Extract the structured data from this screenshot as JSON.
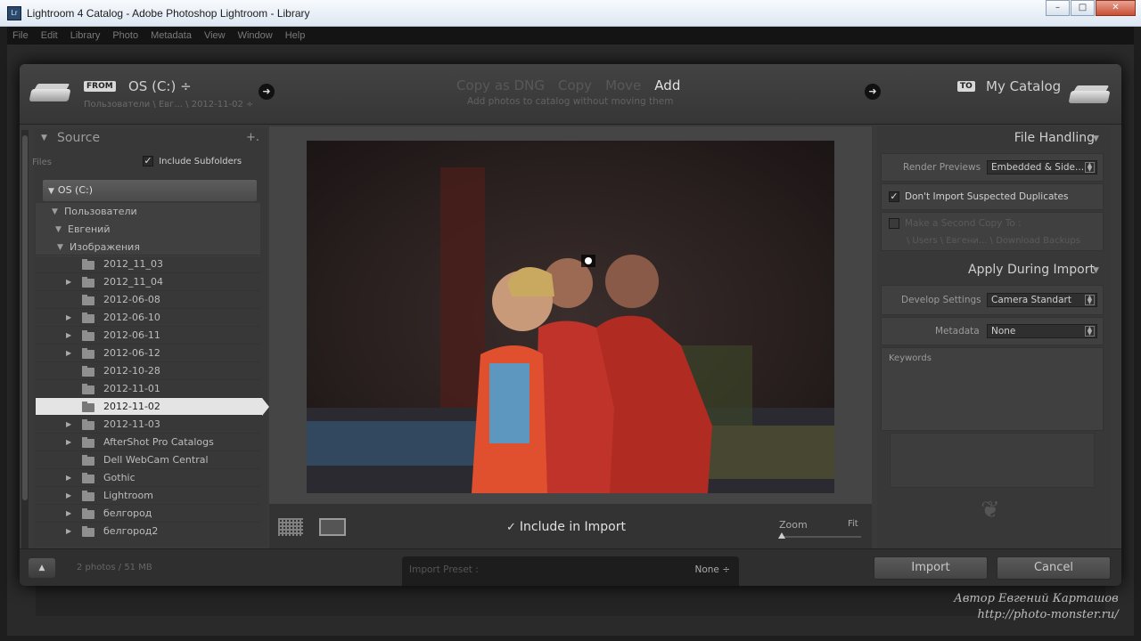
{
  "window": {
    "title": "Lightroom 4 Catalog - Adobe Photoshop Lightroom - Library",
    "app_icon": "Lr",
    "buttons": [
      "–",
      "□",
      "✕"
    ]
  },
  "menubar": {
    "items": [
      "File",
      "Edit",
      "Library",
      "Photo",
      "Metadata",
      "View",
      "Window",
      "Help"
    ]
  },
  "header": {
    "from_tag": "FROM",
    "source": "OS (C:) ÷",
    "source_path": "Пользователи \\ Евг... \\ 2012-11-02 ÷",
    "modes": [
      "Copy as DNG",
      "Copy",
      "Move",
      "Add"
    ],
    "active_mode": "Add",
    "mode_description": "Add photos to catalog without moving them",
    "to_tag": "TO",
    "destination": "My Catalog"
  },
  "source_panel": {
    "title": "Source",
    "add_symbol": "+.",
    "files_label": "Files",
    "include_subfolders": "Include Subfolders",
    "volume": "OS (C:)",
    "tree": [
      "Пользователи",
      "Евгений",
      "Изображения"
    ],
    "folders": [
      {
        "label": "2012_11_03",
        "expand": ""
      },
      {
        "label": "2012_11_04",
        "expand": "▶"
      },
      {
        "label": "2012-06-08",
        "expand": ""
      },
      {
        "label": "2012-06-10",
        "expand": "▶"
      },
      {
        "label": "2012-06-11",
        "expand": "▶"
      },
      {
        "label": "2012-06-12",
        "expand": "▶"
      },
      {
        "label": "2012-10-28",
        "expand": ""
      },
      {
        "label": "2012-11-01",
        "expand": ""
      },
      {
        "label": "2012-11-02",
        "expand": "",
        "selected": true
      },
      {
        "label": "2012-11-03",
        "expand": "▶"
      },
      {
        "label": "AfterShot Pro Catalogs",
        "expand": "▶"
      },
      {
        "label": "Dell WebCam Central",
        "expand": ""
      },
      {
        "label": "Gothic",
        "expand": "▶"
      },
      {
        "label": "Lightroom",
        "expand": "▶"
      },
      {
        "label": "белгород",
        "expand": "▶"
      },
      {
        "label": "белгород2",
        "expand": "▶"
      }
    ]
  },
  "center": {
    "include_in_import": "Include in Import",
    "zoom_label": "Zoom",
    "fit_label": "Fit"
  },
  "file_handling": {
    "title": "File Handling",
    "render_previews_label": "Render Previews",
    "render_previews_value": "Embedded & Side...",
    "dont_import_duplicates": "Don't Import Suspected Duplicates",
    "second_copy_label": "Make a Second Copy To :",
    "second_copy_path": "\\ Users \\ Евгени... \\ Download Backups"
  },
  "apply_during_import": {
    "title": "Apply During Import",
    "develop_settings_label": "Develop Settings",
    "develop_settings_value": "Camera Standart",
    "metadata_label": "Metadata",
    "metadata_value": "None",
    "keywords_label": "Keywords"
  },
  "footer": {
    "up_symbol": "▲",
    "photo_count": "2 photos / 51 MB",
    "import_preset_label": "Import Preset :",
    "import_preset_value": "None ÷",
    "import_button": "Import",
    "cancel_button": "Cancel"
  },
  "watermark": {
    "line1": "Автор Евгений Карташов",
    "line2": "http://photo-monster.ru/"
  }
}
